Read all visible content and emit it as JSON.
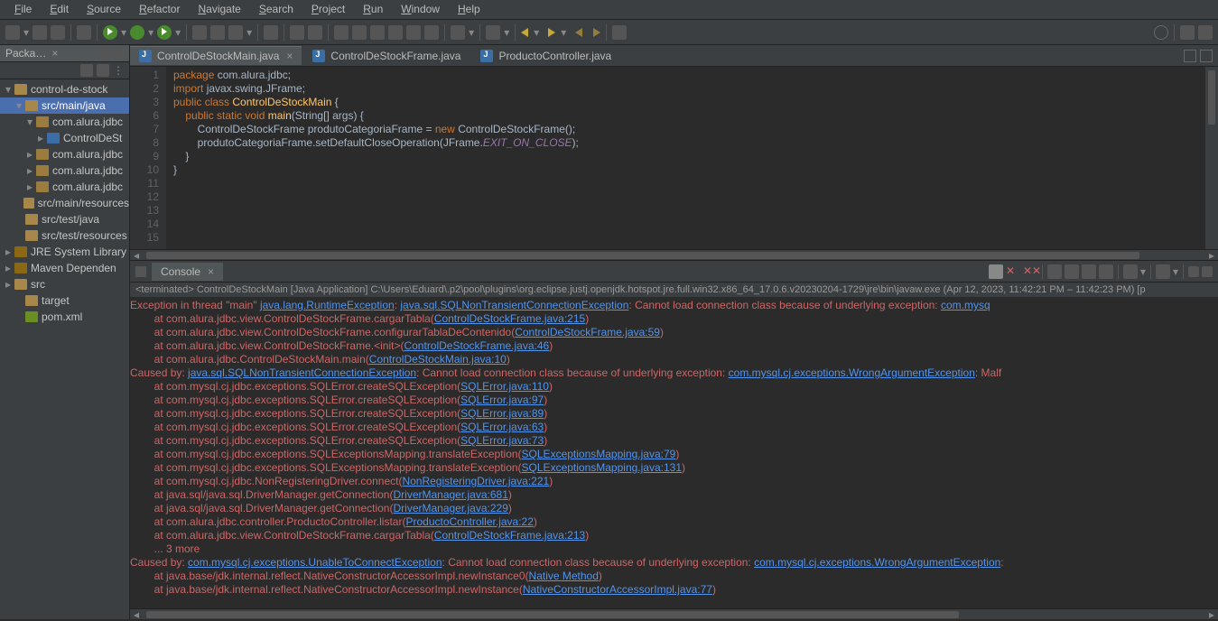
{
  "menu": [
    "File",
    "Edit",
    "Source",
    "Refactor",
    "Navigate",
    "Search",
    "Project",
    "Run",
    "Window",
    "Help"
  ],
  "sidebar": {
    "title": "Packa…",
    "tree": [
      {
        "d": 0,
        "tw": "▾",
        "ico": "fico",
        "txt": "control-de-stock"
      },
      {
        "d": 1,
        "tw": "▾",
        "ico": "fico",
        "txt": "src/main/java",
        "sel": true
      },
      {
        "d": 2,
        "tw": "▾",
        "ico": "fico pkg",
        "txt": "com.alura.jdbc"
      },
      {
        "d": 3,
        "tw": "▸",
        "ico": "fico cls",
        "txt": "ControlDeSt"
      },
      {
        "d": 2,
        "tw": "▸",
        "ico": "fico pkg",
        "txt": "com.alura.jdbc"
      },
      {
        "d": 2,
        "tw": "▸",
        "ico": "fico pkg",
        "txt": "com.alura.jdbc"
      },
      {
        "d": 2,
        "tw": "▸",
        "ico": "fico pkg",
        "txt": "com.alura.jdbc"
      },
      {
        "d": 1,
        "tw": "",
        "ico": "fico",
        "txt": "src/main/resources"
      },
      {
        "d": 1,
        "tw": "",
        "ico": "fico",
        "txt": "src/test/java"
      },
      {
        "d": 1,
        "tw": "",
        "ico": "fico",
        "txt": "src/test/resources"
      },
      {
        "d": 0,
        "tw": "▸",
        "ico": "fico jar",
        "txt": "JRE System Library"
      },
      {
        "d": 0,
        "tw": "▸",
        "ico": "fico jar",
        "txt": "Maven Dependen"
      },
      {
        "d": 0,
        "tw": "▸",
        "ico": "fico",
        "txt": "src"
      },
      {
        "d": 1,
        "tw": "",
        "ico": "fico",
        "txt": "target"
      },
      {
        "d": 1,
        "tw": "",
        "ico": "fico xml",
        "txt": "pom.xml"
      }
    ]
  },
  "tabs": [
    {
      "name": "ControlDeStockMain.java",
      "active": true
    },
    {
      "name": "ControlDeStockFrame.java",
      "active": false
    },
    {
      "name": "ProductoController.java",
      "active": false
    }
  ],
  "code": {
    "gutter": [
      "1",
      "2",
      "3",
      "6",
      "7",
      "8",
      "9",
      "10",
      "11",
      "12",
      "13",
      "14",
      "15"
    ],
    "lines": [
      [
        [
          "kw",
          "package "
        ],
        [
          "pkg",
          "com.alura.jdbc"
        ],
        [
          "",
          ";"
        ]
      ],
      [
        [
          "",
          ""
        ]
      ],
      [
        [
          "kw",
          "import "
        ],
        [
          "pkg",
          "javax.swing.JFrame"
        ],
        [
          "",
          ";"
        ]
      ],
      [
        [
          "",
          ""
        ]
      ],
      [
        [
          "kw",
          "public class "
        ],
        [
          "cls",
          "ControlDeStockMain"
        ],
        [
          "",
          " {"
        ]
      ],
      [
        [
          "",
          ""
        ]
      ],
      [
        [
          "",
          "    "
        ],
        [
          "kw",
          "public static void "
        ],
        [
          "cls",
          "main"
        ],
        [
          "",
          "("
        ],
        [
          "typ",
          "String"
        ],
        [
          "",
          "[] "
        ],
        [
          "",
          "args"
        ],
        [
          "",
          ") {"
        ]
      ],
      [
        [
          "",
          "        "
        ],
        [
          "typ",
          "ControlDeStockFrame"
        ],
        [
          "",
          " "
        ],
        [
          "",
          "produtoCategoriaFrame"
        ],
        [
          "",
          " = "
        ],
        [
          "kw",
          "new "
        ],
        [
          "typ",
          "ControlDeStockFrame"
        ],
        [
          "",
          "();"
        ]
      ],
      [
        [
          "",
          "        produtoCategoriaFrame.setDefaultCloseOperation("
        ],
        [
          "typ",
          "JFrame"
        ],
        [
          "",
          "."
        ],
        [
          "fld",
          "EXIT_ON_CLOSE"
        ],
        [
          "",
          ");"
        ]
      ],
      [
        [
          "",
          "    }"
        ]
      ],
      [
        [
          "",
          ""
        ]
      ],
      [
        [
          "",
          "}"
        ]
      ],
      [
        [
          "",
          ""
        ]
      ]
    ]
  },
  "console": {
    "title": "Console",
    "header": "<terminated> ControlDeStockMain [Java Application] C:\\Users\\Eduard\\.p2\\pool\\plugins\\org.eclipse.justj.openjdk.hotspot.jre.full.win32.x86_64_17.0.6.v20230204-1729\\jre\\bin\\javaw.exe  (Apr 12, 2023, 11:42:21 PM – 11:42:23 PM) [p",
    "lines": [
      [
        [
          "err",
          "Exception in thread \"main\" "
        ],
        [
          "link",
          "java.lang.RuntimeException"
        ],
        [
          "err",
          ": "
        ],
        [
          "link",
          "java.sql.SQLNonTransientConnectionException"
        ],
        [
          "err",
          ": Cannot load connection class because of underlying exception: "
        ],
        [
          "link",
          "com.mysq"
        ]
      ],
      [
        [
          "trace",
          "        at com.alura.jdbc.view.ControlDeStockFrame.cargarTabla("
        ],
        [
          "link",
          "ControlDeStockFrame.java:215"
        ],
        [
          "trace",
          ")"
        ]
      ],
      [
        [
          "trace",
          "        at com.alura.jdbc.view.ControlDeStockFrame.configurarTablaDeContenido("
        ],
        [
          "link",
          "ControlDeStockFrame.java:59"
        ],
        [
          "trace",
          ")"
        ]
      ],
      [
        [
          "trace",
          "        at com.alura.jdbc.view.ControlDeStockFrame.<init>("
        ],
        [
          "link",
          "ControlDeStockFrame.java:46"
        ],
        [
          "trace",
          ")"
        ]
      ],
      [
        [
          "trace",
          "        at com.alura.jdbc.ControlDeStockMain.main("
        ],
        [
          "link",
          "ControlDeStockMain.java:10"
        ],
        [
          "trace",
          ")"
        ]
      ],
      [
        [
          "caused",
          "Caused by: "
        ],
        [
          "link",
          "java.sql.SQLNonTransientConnectionException"
        ],
        [
          "err",
          ": Cannot load connection class because of underlying exception: "
        ],
        [
          "link",
          "com.mysql.cj.exceptions.WrongArgumentException"
        ],
        [
          "err",
          ": Malf"
        ]
      ],
      [
        [
          "trace",
          "        at com.mysql.cj.jdbc.exceptions.SQLError.createSQLException("
        ],
        [
          "link",
          "SQLError.java:110"
        ],
        [
          "trace",
          ")"
        ]
      ],
      [
        [
          "trace",
          "        at com.mysql.cj.jdbc.exceptions.SQLError.createSQLException("
        ],
        [
          "link",
          "SQLError.java:97"
        ],
        [
          "trace",
          ")"
        ]
      ],
      [
        [
          "trace",
          "        at com.mysql.cj.jdbc.exceptions.SQLError.createSQLException("
        ],
        [
          "link",
          "SQLError.java:89"
        ],
        [
          "trace",
          ")"
        ]
      ],
      [
        [
          "trace",
          "        at com.mysql.cj.jdbc.exceptions.SQLError.createSQLException("
        ],
        [
          "link",
          "SQLError.java:63"
        ],
        [
          "trace",
          ")"
        ]
      ],
      [
        [
          "trace",
          "        at com.mysql.cj.jdbc.exceptions.SQLError.createSQLException("
        ],
        [
          "link",
          "SQLError.java:73"
        ],
        [
          "trace",
          ")"
        ]
      ],
      [
        [
          "trace",
          "        at com.mysql.cj.jdbc.exceptions.SQLExceptionsMapping.translateException("
        ],
        [
          "link",
          "SQLExceptionsMapping.java:79"
        ],
        [
          "trace",
          ")"
        ]
      ],
      [
        [
          "trace",
          "        at com.mysql.cj.jdbc.exceptions.SQLExceptionsMapping.translateException("
        ],
        [
          "link",
          "SQLExceptionsMapping.java:131"
        ],
        [
          "trace",
          ")"
        ]
      ],
      [
        [
          "trace",
          "        at com.mysql.cj.jdbc.NonRegisteringDriver.connect("
        ],
        [
          "link",
          "NonRegisteringDriver.java:221"
        ],
        [
          "trace",
          ")"
        ]
      ],
      [
        [
          "trace",
          "        at java.sql/java.sql.DriverManager.getConnection("
        ],
        [
          "link",
          "DriverManager.java:681"
        ],
        [
          "trace",
          ")"
        ]
      ],
      [
        [
          "trace",
          "        at java.sql/java.sql.DriverManager.getConnection("
        ],
        [
          "link",
          "DriverManager.java:229"
        ],
        [
          "trace",
          ")"
        ]
      ],
      [
        [
          "trace",
          "        at com.alura.jdbc.controller.ProductoController.listar("
        ],
        [
          "link",
          "ProductoController.java:22"
        ],
        [
          "trace",
          ")"
        ]
      ],
      [
        [
          "trace",
          "        at com.alura.jdbc.view.ControlDeStockFrame.cargarTabla("
        ],
        [
          "link",
          "ControlDeStockFrame.java:213"
        ],
        [
          "trace",
          ")"
        ]
      ],
      [
        [
          "trace",
          "        ... 3 more"
        ]
      ],
      [
        [
          "caused",
          "Caused by: "
        ],
        [
          "link",
          "com.mysql.cj.exceptions.UnableToConnectException"
        ],
        [
          "err",
          ": Cannot load connection class because of underlying exception: "
        ],
        [
          "link",
          "com.mysql.cj.exceptions.WrongArgumentException"
        ],
        [
          "err",
          ":"
        ]
      ],
      [
        [
          "trace",
          "        at java.base/jdk.internal.reflect.NativeConstructorAccessorImpl.newInstance0("
        ],
        [
          "link",
          "Native Method"
        ],
        [
          "trace",
          ")"
        ]
      ],
      [
        [
          "trace",
          "        at java.base/jdk.internal.reflect.NativeConstructorAccessorImpl.newInstance("
        ],
        [
          "link",
          "NativeConstructorAccessorImpl.java:77"
        ],
        [
          "trace",
          ")"
        ]
      ]
    ]
  }
}
